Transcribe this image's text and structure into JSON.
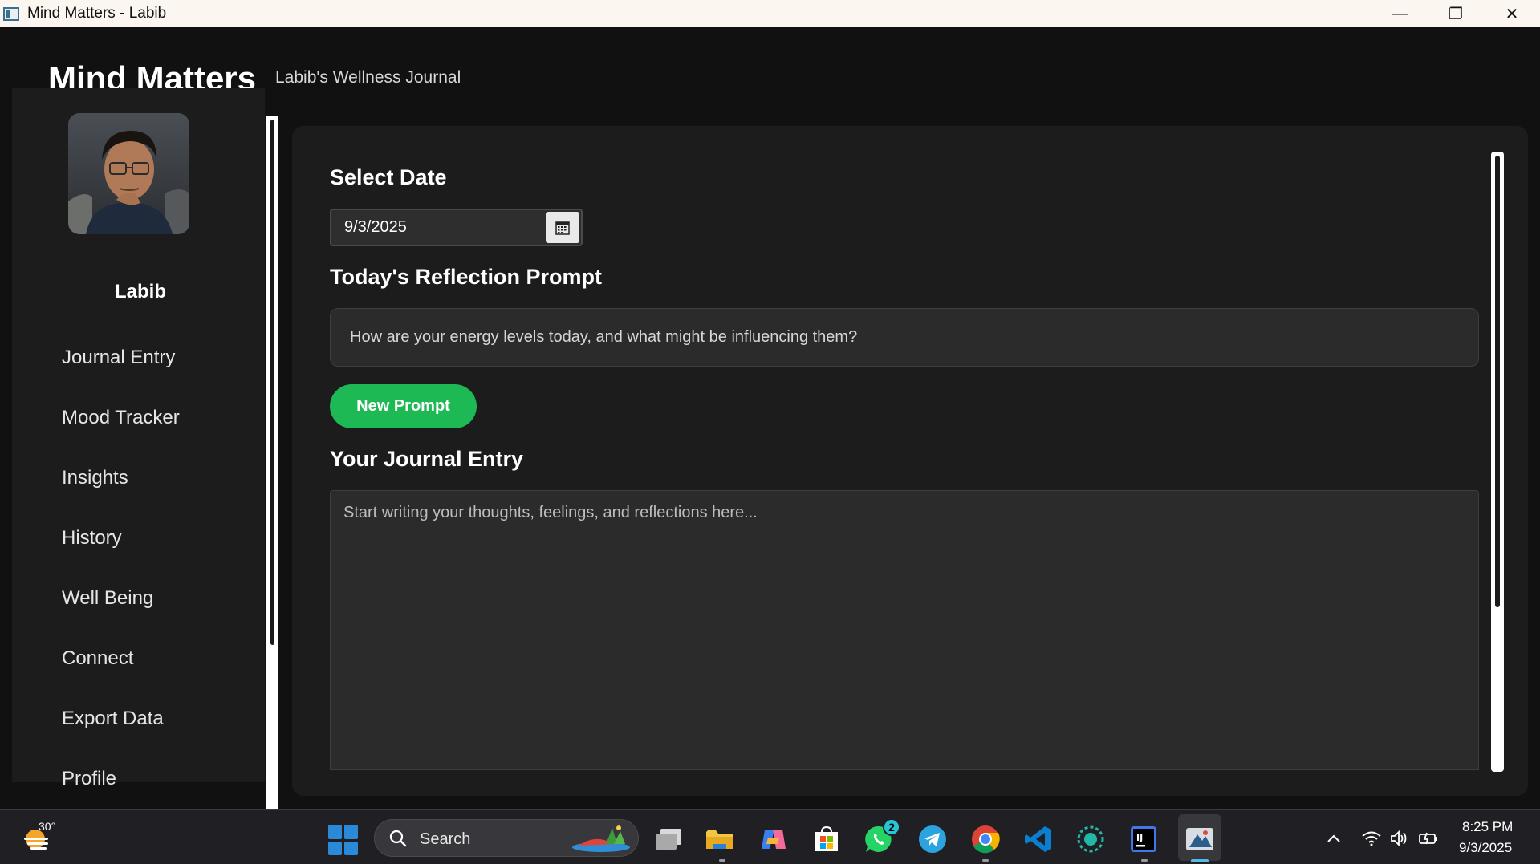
{
  "window": {
    "title": "Mind Matters - Labib",
    "minimize_glyph": "—",
    "restore_glyph": "❐",
    "close_glyph": "✕"
  },
  "header": {
    "title": "Mind Matters",
    "subtitle": "Labib's Wellness Journal"
  },
  "sidebar": {
    "username": "Labib",
    "items": [
      {
        "label": "Journal Entry"
      },
      {
        "label": "Mood Tracker"
      },
      {
        "label": "Insights"
      },
      {
        "label": "History"
      },
      {
        "label": "Well Being"
      },
      {
        "label": "Connect"
      },
      {
        "label": "Export Data"
      },
      {
        "label": "Profile"
      }
    ]
  },
  "main": {
    "select_date_label": "Select Date",
    "date_value": "9/3/2025",
    "prompt_heading": "Today's Reflection Prompt",
    "prompt_text": "How are your energy levels today, and what might be influencing them?",
    "new_prompt_button": "New Prompt",
    "journal_heading": "Your Journal Entry",
    "journal_placeholder": "Start writing your thoughts, feelings, and reflections here..."
  },
  "taskbar": {
    "weather_temp": "30°",
    "search_placeholder": "Search",
    "whatsapp_badge": "2",
    "clock_time": "8:25 PM",
    "clock_date": "9/3/2025",
    "pinned_icons": [
      "file-explorer-icon",
      "folder-icon",
      "copilot-icon",
      "microsoft-store-icon",
      "whatsapp-icon",
      "telegram-icon",
      "chrome-icon",
      "vscode-icon",
      "screen-recorder-icon",
      "intellij-icon",
      "java-app-icon"
    ]
  },
  "colors": {
    "accent_green": "#1db954",
    "background": "#111111",
    "panel": "#1c1c1c"
  }
}
